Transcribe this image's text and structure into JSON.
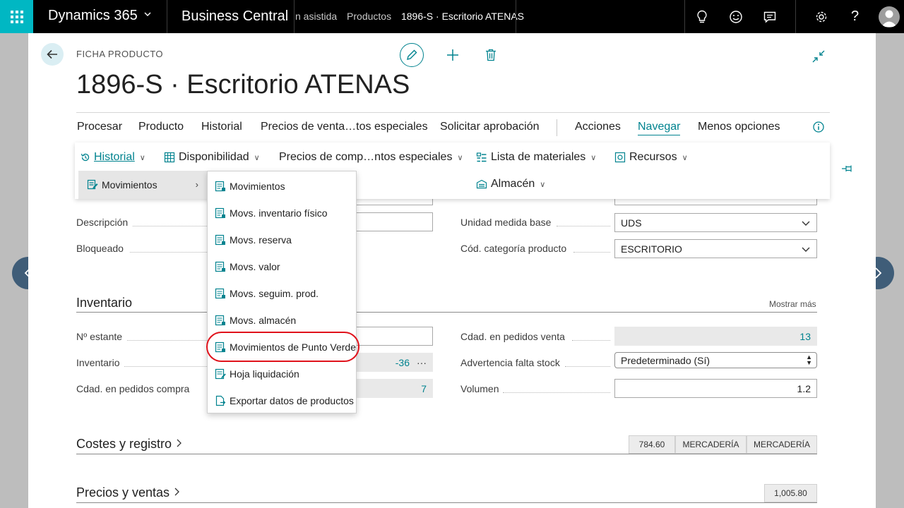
{
  "topbar": {
    "brand": "Dynamics 365",
    "app": "Business Central",
    "breadcrumb": [
      "n asistida",
      "Productos",
      "1896-S · Escritorio ATENAS"
    ],
    "icons": [
      "lightbulb-icon",
      "smiley-icon",
      "chat-icon",
      "gear-icon",
      "help-icon",
      "avatar-icon"
    ],
    "help_label": "?"
  },
  "page": {
    "caption": "FICHA PRODUCTO",
    "title": "1896-S · Escritorio ATENAS"
  },
  "actionbar": {
    "items": [
      "Procesar",
      "Producto",
      "Historial",
      "Precios de venta…tos especiales",
      "Solicitar aprobación",
      "Acciones",
      "Navegar",
      "Menos opciones"
    ],
    "active": "Navegar"
  },
  "ribbon": {
    "items": [
      "Historial",
      "Disponibilidad",
      "Precios de comp…ntos especiales",
      "Lista de materiales",
      "Recursos",
      "Almacén"
    ]
  },
  "submenu": {
    "parent": "Movimientos",
    "items": [
      "Movimientos",
      "Movs. inventario físico",
      "Movs. reserva",
      "Movs. valor",
      "Movs. seguim. prod.",
      "Movs. almacén",
      "Movimientos de Punto Verde",
      "Hoja liquidación",
      "Exportar datos de productos"
    ],
    "highlighted": "Movimientos de Punto Verde",
    "highlight_color": "#e0121b"
  },
  "general": {
    "descripcion_label": "Descripción",
    "bloqueado_label": "Bloqueado",
    "unidad_label": "Unidad medida base",
    "unidad_value": "UDS",
    "categoria_label": "Cód. categoría producto",
    "categoria_value": "ESCRITORIO"
  },
  "inventario": {
    "title": "Inventario",
    "show_more": "Mostrar más",
    "estante_label": "Nº estante",
    "inventario_label": "Inventario",
    "inventario_value": "-36",
    "more_glyph": "···",
    "pedidos_compra_label": "Cdad. en pedidos compra",
    "pedidos_compra_value": "7",
    "pedidos_venta_label": "Cdad. en pedidos venta",
    "pedidos_venta_value": "13",
    "advertencia_label": "Advertencia falta stock",
    "advertencia_value": "Predeterminado (Sí)",
    "volumen_label": "Volumen",
    "volumen_value": "1.2"
  },
  "costes": {
    "title": "Costes y registro",
    "tags": [
      "784.60",
      "MERCADERÍA",
      "MERCADERÍA"
    ]
  },
  "precios": {
    "title": "Precios y ventas",
    "tags": [
      "1,005.80"
    ]
  },
  "colors": {
    "accent": "#00838f",
    "waffle": "#00b7c3",
    "nav_arrow": "#3f5d78"
  }
}
